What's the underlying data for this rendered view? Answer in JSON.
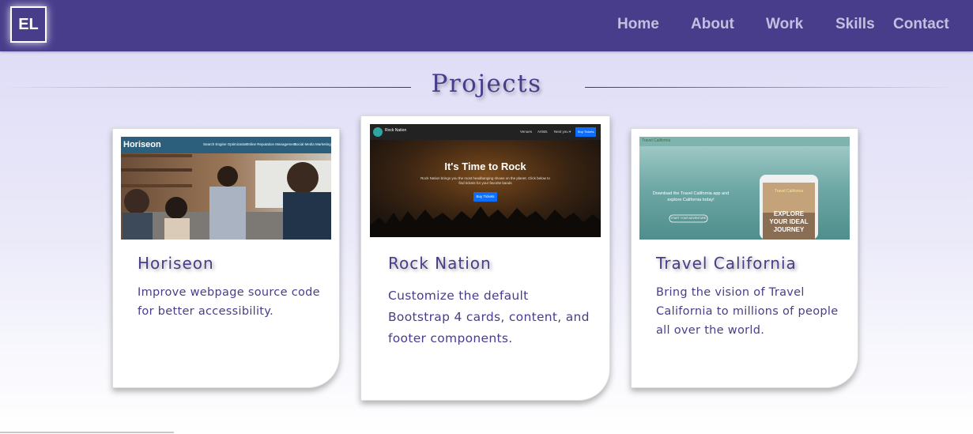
{
  "nav": {
    "logo": "EL",
    "links": [
      "Home",
      "About",
      "Work",
      "Skills",
      "Contact"
    ]
  },
  "projects": {
    "title": "Projects",
    "cards": [
      {
        "title": "Horiseon",
        "description": "Improve webpage source code for better accessibility.",
        "screenshot": {
          "brand": "Horiseon",
          "nav": [
            "Search Engine Optimization",
            "Online Reputation Management",
            "Social Media Marketing"
          ]
        }
      },
      {
        "title": "Rock Nation",
        "description": "Customize the default Bootstrap 4 cards, content, and footer components.",
        "screenshot": {
          "brand": "Rock Nation",
          "nav": [
            "Venues",
            "Artists",
            "Next you ▾"
          ],
          "button": "Buy Tickets",
          "headline": "It's Time to Rock",
          "tagline": "Rock Nation brings you the most headbanging shows on the planet. Click below to find tickets for your favorite bands",
          "cta": "Buy Tickets"
        }
      },
      {
        "title": "Travel California",
        "description": "Bring the vision of Travel California to millions of people all over the world.",
        "screenshot": {
          "brand": "Travel California",
          "tagline": "Download the Travel California app and explore California today!",
          "button": "START YOUR ADVENTURE",
          "phone_title": "Travel California",
          "phone_text": "EXPLORE YOUR IDEAL JOURNEY"
        }
      }
    ]
  },
  "colors": {
    "primary": "#483d8b",
    "accent_blue": "#0d6efd"
  }
}
